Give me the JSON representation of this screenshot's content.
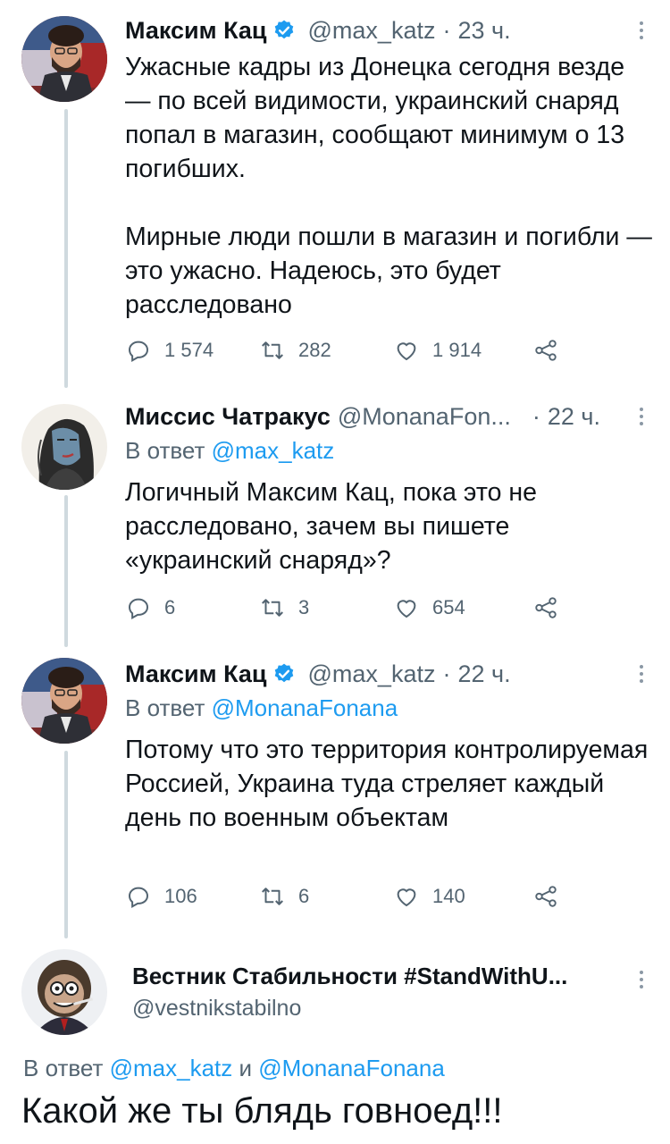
{
  "tweets": [
    {
      "name": "Максим Кац",
      "handle": "@max_katz",
      "time": "23 ч.",
      "reply_prefix": "",
      "reply_to": "",
      "text": "Ужасные кадры из Донецка сегодня везде — по всей видимости, украинский снаряд попал в магазин, сообщают минимум о 13 погибших.\n\nМирные люди пошли в магазин и погибли — это ужасно. Надеюсь, это будет расследовано",
      "replies": "1 574",
      "retweets": "282",
      "likes": "1 914"
    },
    {
      "name": "Миссис Чатракус",
      "handle": "@MonanaFon...",
      "time": "22 ч.",
      "reply_prefix": "В ответ ",
      "reply_to": "@max_katz",
      "text": "Логичный Максим Кац, пока это не расследовано, зачем вы пишете «украинский снаряд»?",
      "replies": "6",
      "retweets": "3",
      "likes": "654"
    },
    {
      "name": "Максим Кац",
      "handle": "@max_katz",
      "time": "22 ч.",
      "reply_prefix": "В ответ ",
      "reply_to": "@MonanaFonana",
      "text": "Потому что это территория контролируемая Россией, Украина туда стреляет каждый день по военным объектам",
      "replies": "106",
      "retweets": "6",
      "likes": "140"
    }
  ],
  "final": {
    "name": "Вестник Стабильности #StandWithU...",
    "handle": "@vestnikstabilno",
    "reply_prefix": "В ответ ",
    "reply_to_1": "@max_katz",
    "reply_and": " и ",
    "reply_to_2": "@MonanaFonana",
    "text": "Какой же ты блядь говноед!!!"
  },
  "colors": {
    "link": "#1d9bf0",
    "muted": "#536471",
    "text": "#0f1419",
    "thread": "#cfd9de"
  },
  "icons": [
    "verified-badge-icon",
    "more-icon",
    "reply-icon",
    "retweet-icon",
    "like-icon",
    "share-icon"
  ]
}
